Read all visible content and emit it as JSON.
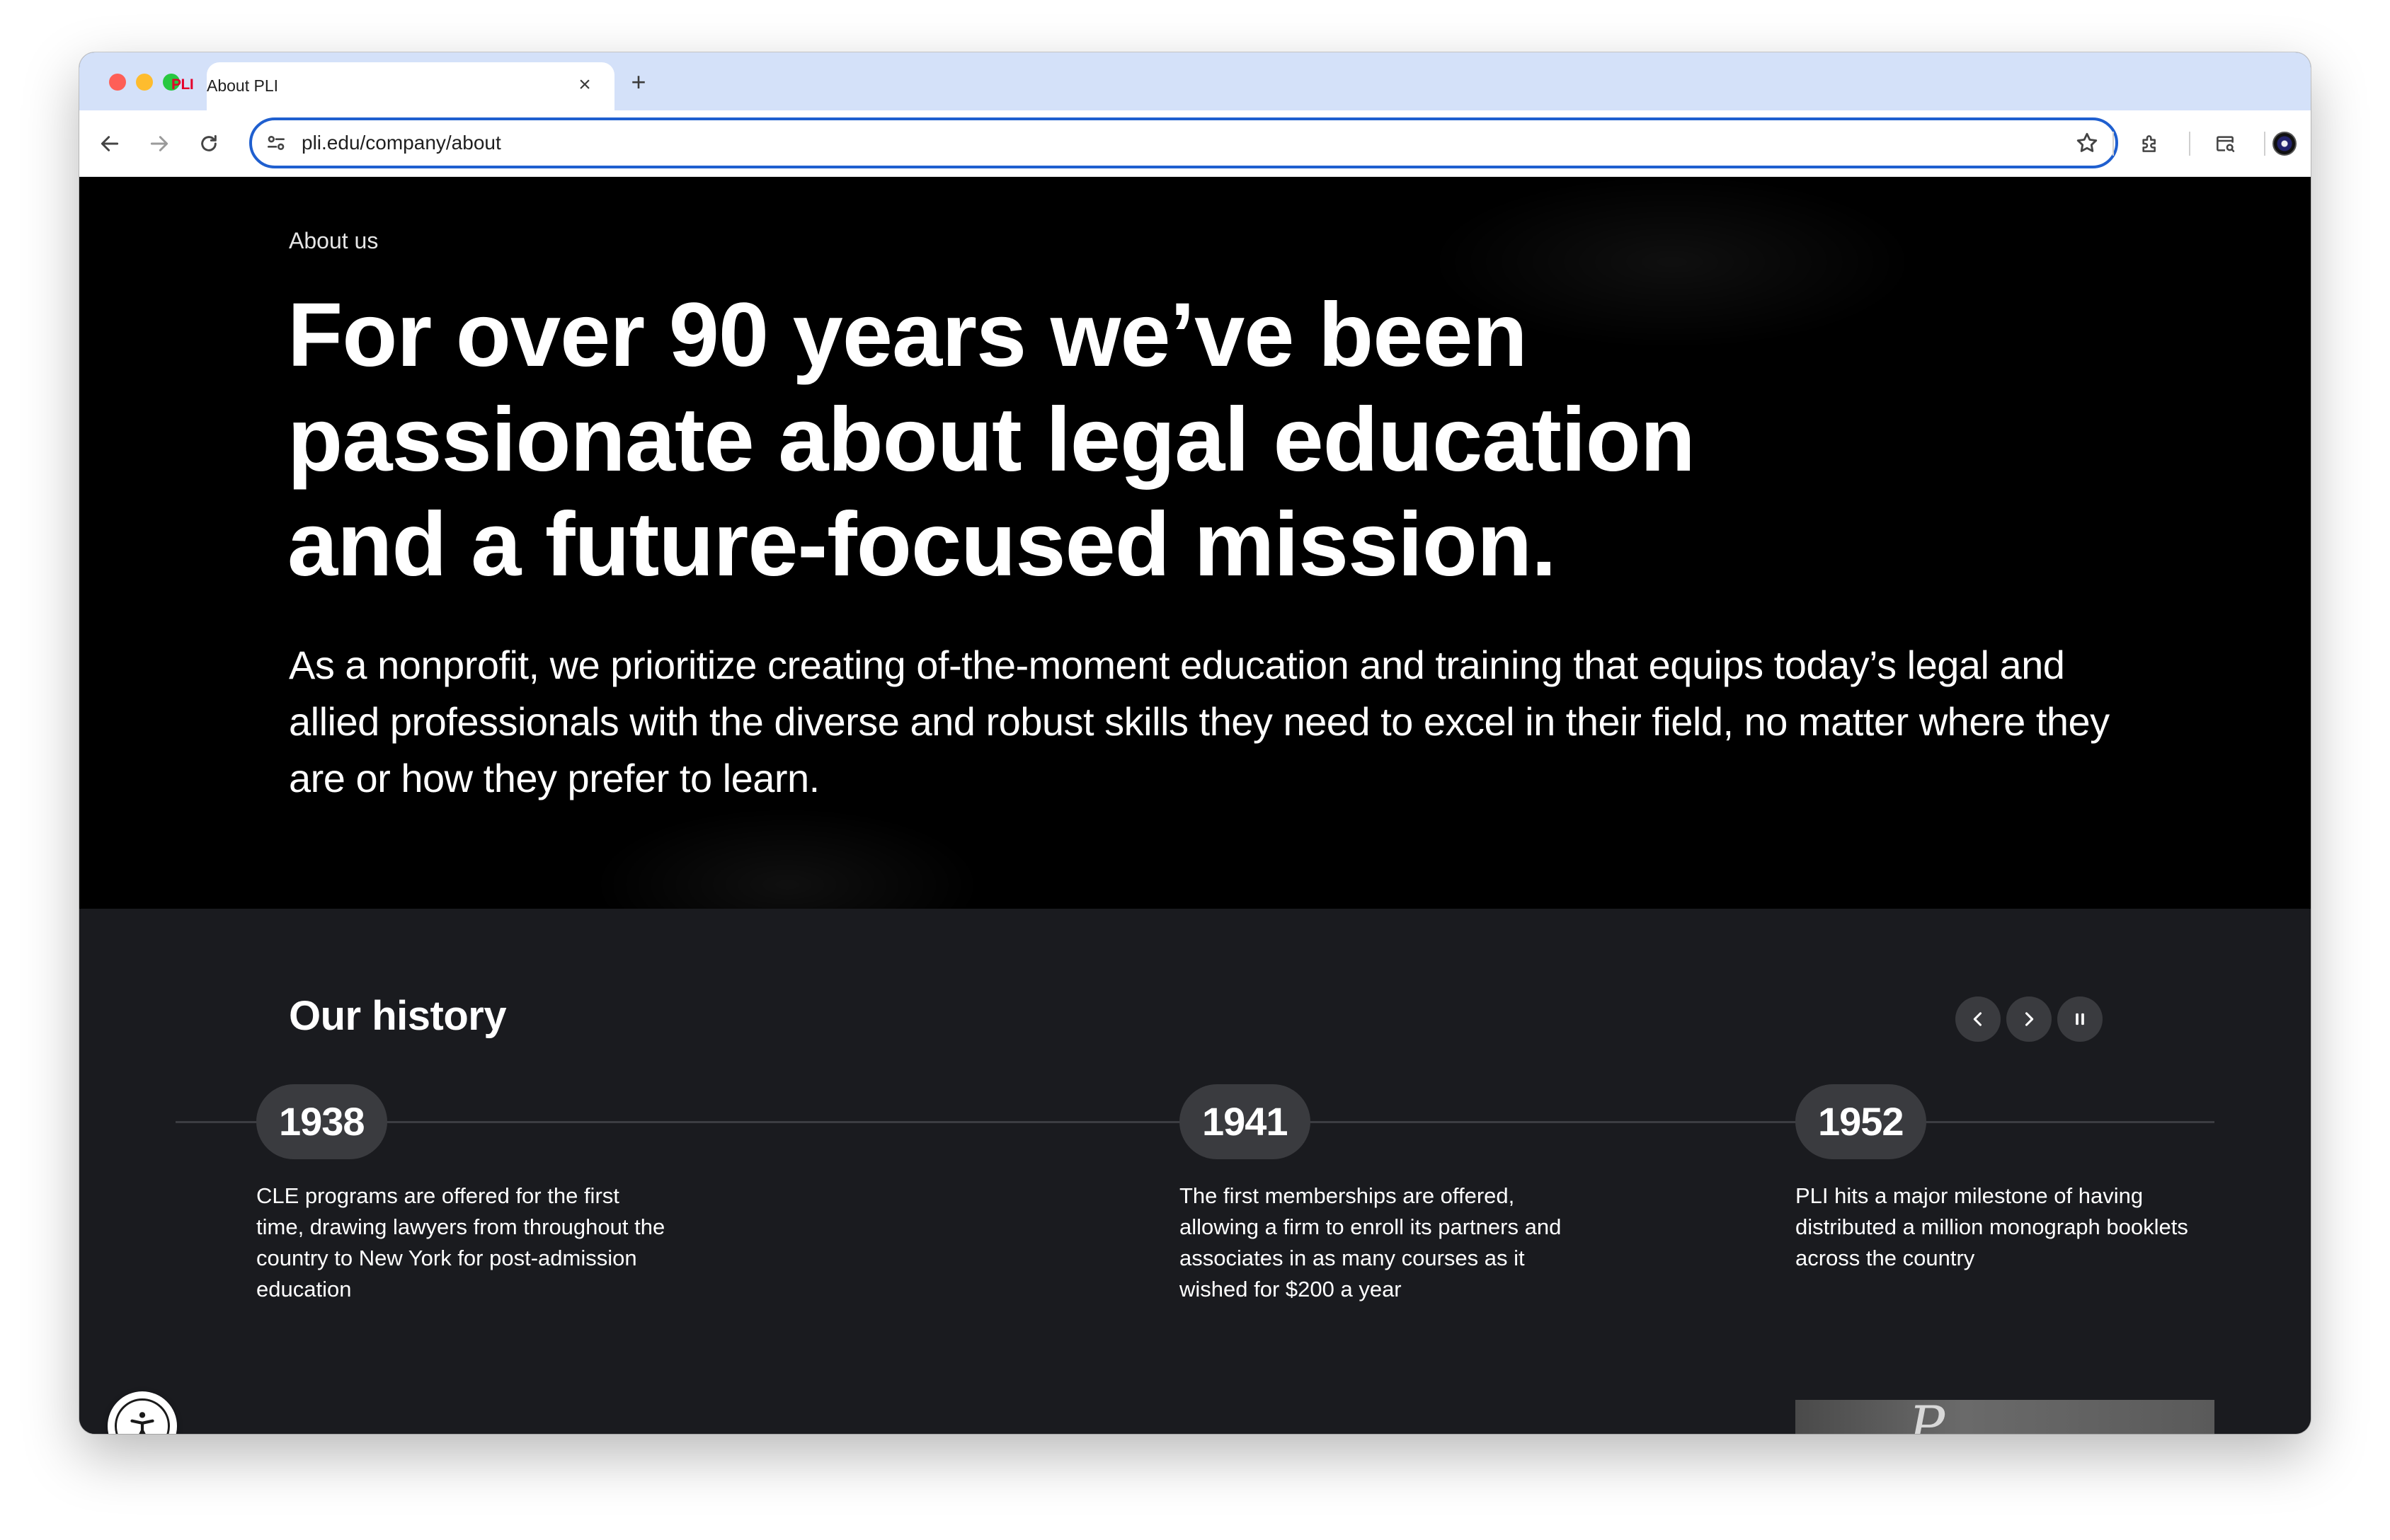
{
  "browser": {
    "tab": {
      "favicon_text": "PLI",
      "title": "About PLI",
      "close_glyph": "×"
    },
    "new_tab_glyph": "+",
    "address": {
      "url": "pli.edu/company/about"
    }
  },
  "hero": {
    "eyebrow": "About us",
    "title": "For over 90 years we’ve been\npassionate about legal education\nand a future-focused mission.",
    "body": "As a nonprofit, we prioritize creating of-the-moment education and training that equips today’s legal and allied professionals with the diverse and robust skills they need to excel in their field, no matter where they are or how they prefer to learn."
  },
  "history": {
    "title": "Our history",
    "events": [
      {
        "year": "1938",
        "text": "CLE programs are offered for the first time, drawing lawyers from throughout the country to New York for post-admission education"
      },
      {
        "year": "1941",
        "text": "The first memberships are offered, allowing a firm to enroll its partners and associates in as many courses as it wished for $200 a year"
      },
      {
        "year": "1952",
        "text": "PLI hits a major milestone of having distributed a million monograph booklets across the country"
      }
    ]
  },
  "icons": {
    "back": "arrow-left-icon",
    "forward": "arrow-right-icon",
    "reload": "reload-icon",
    "site_info": "tune-icon",
    "bookmark": "star-icon",
    "extensions": "puzzle-icon",
    "search_tabs": "tab-search-icon",
    "menu": "kebab-menu-icon",
    "prev": "chevron-left-icon",
    "next": "chevron-right-icon",
    "pause": "pause-icon",
    "accessibility": "accessibility-icon"
  },
  "colors": {
    "brand_red": "#e4002b",
    "omnibox_focus": "#1f5fcf",
    "hero_bg": "#000000",
    "history_bg": "#1a1b1f",
    "pill_bg": "#3a3b3f"
  }
}
